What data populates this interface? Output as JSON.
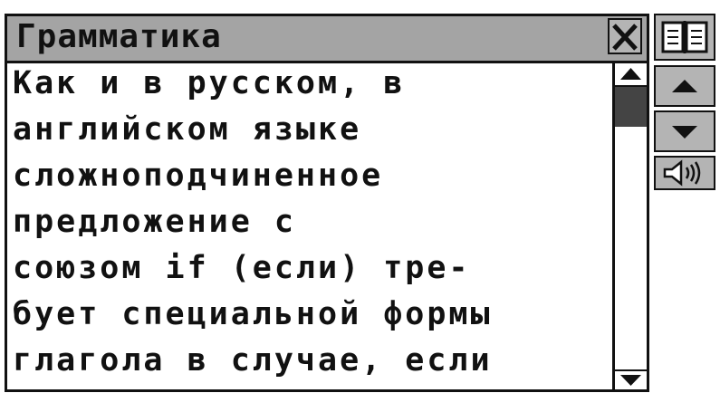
{
  "window": {
    "title": "Грамматика",
    "close_icon": "close-icon"
  },
  "content": {
    "lines": [
      "Как и в русском, в",
      "английском языке",
      "сложноподчиненное",
      "предложение с",
      "союзом if (если) тре-",
      "бует специальной формы",
      "глагола в случае, если"
    ]
  },
  "scrollbar": {
    "up_icon": "scroll-up-arrow-icon",
    "down_icon": "scroll-down-arrow-icon",
    "position_fraction": 0.08
  },
  "side_toolbar": {
    "buttons": [
      {
        "icon": "book-icon"
      },
      {
        "icon": "arrow-up-icon"
      },
      {
        "icon": "arrow-down-icon"
      },
      {
        "icon": "speaker-icon"
      }
    ]
  },
  "colors": {
    "titlebar": "#a4a4a4",
    "button_face": "#b4b4b4",
    "text": "#111111",
    "background": "#ffffff"
  }
}
